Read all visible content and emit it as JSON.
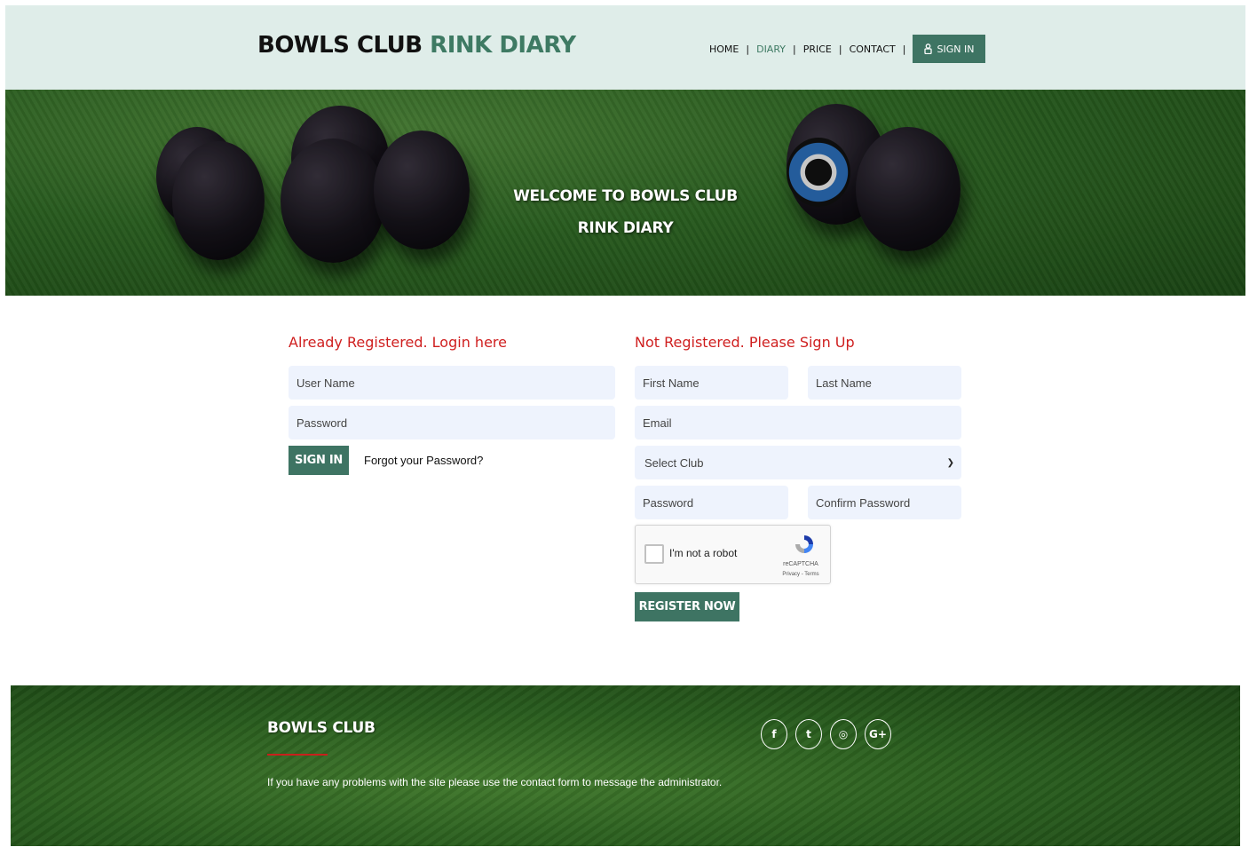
{
  "header": {
    "brand_main": "BOWLS CLUB",
    "brand_accent": "RINK DIARY",
    "nav": {
      "home": "HOME",
      "diary": "DIARY",
      "price": "PRICE",
      "contact": "CONTACT",
      "separator": "|",
      "signin": "SIGN IN",
      "signin_icon": "user-lock-icon"
    }
  },
  "hero": {
    "line1": "WELCOME TO BOWLS CLUB",
    "line2": "RINK DIARY"
  },
  "login": {
    "title": "Already Registered. Login here",
    "username_placeholder": "User Name",
    "password_placeholder": "Password",
    "signin_button": "SIGN IN",
    "forgot_link": "Forgot your Password?"
  },
  "register": {
    "title": "Not Registered. Please Sign Up",
    "first_name_placeholder": "First Name",
    "last_name_placeholder": "Last Name",
    "email_placeholder": "Email",
    "club_select_value": "Select Club",
    "password_placeholder": "Password",
    "confirm_password_placeholder": "Confirm Password",
    "recaptcha_label": "I'm not a robot",
    "recaptcha_brand": "reCAPTCHA",
    "recaptcha_terms": "Privacy - Terms",
    "register_button": "REGISTER NOW"
  },
  "footer": {
    "title": "BOWLS CLUB",
    "text": "If you have any problems with the site please use the contact form to message the administrator.",
    "social": [
      {
        "icon": "facebook-icon",
        "glyph": "f"
      },
      {
        "icon": "twitter-icon",
        "glyph": "t"
      },
      {
        "icon": "instagram-icon",
        "glyph": "◎"
      },
      {
        "icon": "google-plus-icon",
        "glyph": "G+"
      }
    ]
  },
  "colors": {
    "brand_green": "#3e7463",
    "header_bg": "#dfede9",
    "title_red": "#cf1f1f",
    "field_bg": "#eef3fd"
  }
}
